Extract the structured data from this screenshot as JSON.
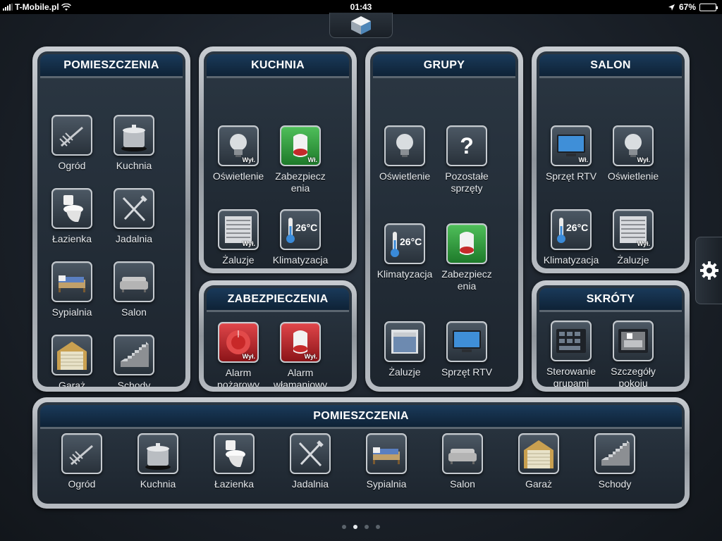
{
  "status_bar": {
    "carrier": "T-Mobile.pl",
    "time": "01:43",
    "battery": "67%",
    "battery_level": 0.67
  },
  "icons": {
    "logo": "cube-logo-icon",
    "settings": "gear-icon"
  },
  "panels": {
    "pomieszczenia_side": {
      "title": "POMIESZCZENIA",
      "items": [
        {
          "label": "Ogród",
          "icon": "rake-icon"
        },
        {
          "label": "Kuchnia",
          "icon": "pot-icon"
        },
        {
          "label": "Łazienka",
          "icon": "toilet-icon"
        },
        {
          "label": "Jadalnia",
          "icon": "cutlery-icon"
        },
        {
          "label": "Sypialnia",
          "icon": "bed-icon"
        },
        {
          "label": "Salon",
          "icon": "sofa-icon"
        },
        {
          "label": "Garaż",
          "icon": "garage-icon"
        },
        {
          "label": "Schody",
          "icon": "stairs-icon"
        }
      ]
    },
    "kuchnia": {
      "title": "KUCHNIA",
      "items": [
        {
          "label": "Oświetlenie",
          "icon": "lightbulb-icon",
          "badge": "Wył."
        },
        {
          "label": "Zabezpiecz enia",
          "icon": "siren-icon",
          "badge": "Wł."
        },
        {
          "label": "Żaluzje",
          "icon": "blinds-icon",
          "badge": "Wył."
        },
        {
          "label": "Klimatyzacja",
          "icon": "thermometer-icon",
          "temp": "26°C"
        }
      ]
    },
    "zabezpieczenia": {
      "title": "ZABEZPIECZENIA",
      "items": [
        {
          "label": "Alarm pożarowy",
          "icon": "fire-bell-icon",
          "badge": "Wył."
        },
        {
          "label": "Alarm włamaniowy",
          "icon": "siren-icon",
          "badge": "Wył."
        }
      ]
    },
    "grupy": {
      "title": "GRUPY",
      "items": [
        {
          "label": "Oświetlenie",
          "icon": "lightbulb-icon"
        },
        {
          "label": "Pozostałe sprzęty",
          "icon": "question-icon"
        },
        {
          "label": "Klimatyzacja",
          "icon": "thermometer-icon",
          "temp": "26°C"
        },
        {
          "label": "Zabezpiecz enia",
          "icon": "siren-icon"
        },
        {
          "label": "Żaluzje",
          "icon": "window-icon"
        },
        {
          "label": "Sprzęt RTV",
          "icon": "tv-icon"
        }
      ]
    },
    "salon": {
      "title": "SALON",
      "items": [
        {
          "label": "Sprzęt RTV",
          "icon": "tv-icon",
          "badge": "Wł."
        },
        {
          "label": "Oświetlenie",
          "icon": "lightbulb-icon",
          "badge": "Wył."
        },
        {
          "label": "Klimatyzacja",
          "icon": "thermometer-icon",
          "temp": "26°C"
        },
        {
          "label": "Żaluzje",
          "icon": "blinds-icon",
          "badge": "Wył."
        }
      ]
    },
    "skroty": {
      "title": "SKRÓTY",
      "items": [
        {
          "label": "Sterowanie grupami",
          "icon": "group-control-icon"
        },
        {
          "label": "Szczegóły pokoju",
          "icon": "room-details-icon"
        }
      ]
    },
    "pomieszczenia_bottom": {
      "title": "POMIESZCZENIA",
      "items": [
        {
          "label": "Ogród",
          "icon": "rake-icon"
        },
        {
          "label": "Kuchnia",
          "icon": "pot-icon"
        },
        {
          "label": "Łazienka",
          "icon": "toilet-icon"
        },
        {
          "label": "Jadalnia",
          "icon": "cutlery-icon"
        },
        {
          "label": "Sypialnia",
          "icon": "bed-icon"
        },
        {
          "label": "Salon",
          "icon": "sofa-icon"
        },
        {
          "label": "Garaż",
          "icon": "garage-icon"
        },
        {
          "label": "Schody",
          "icon": "stairs-icon"
        }
      ]
    }
  },
  "pagination": {
    "count": 4,
    "active_index": 1
  }
}
